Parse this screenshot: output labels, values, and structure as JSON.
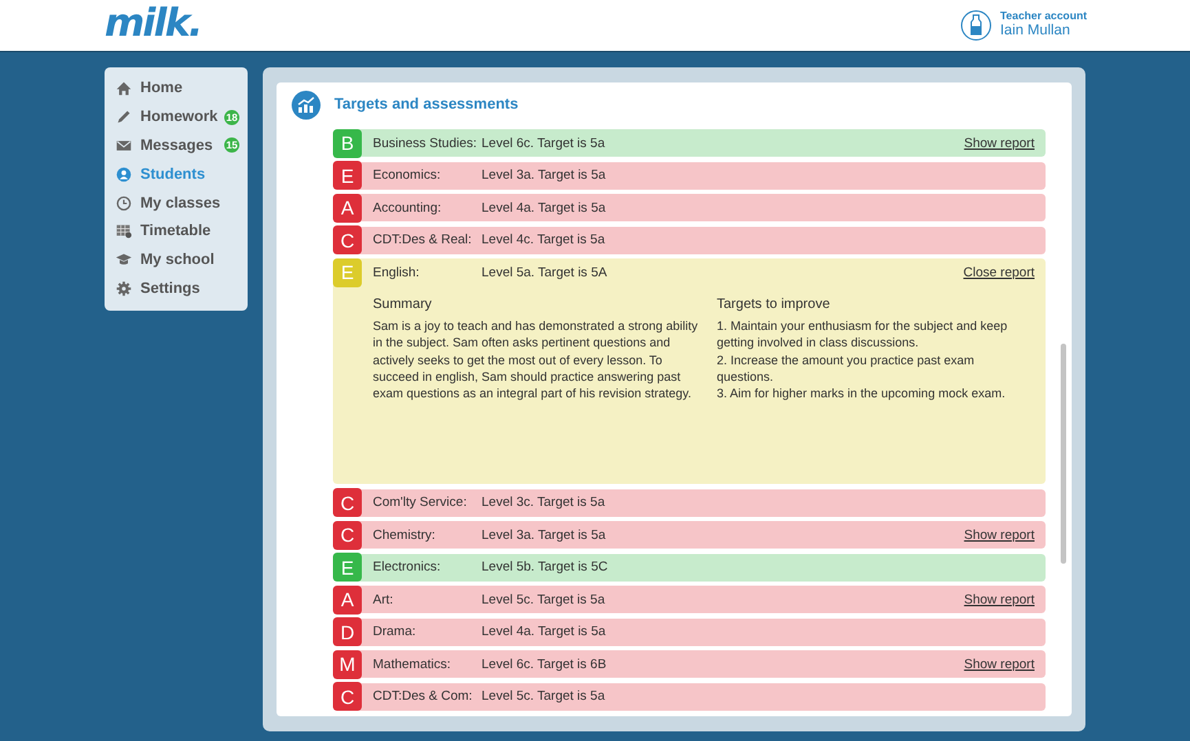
{
  "header": {
    "logo": "milk.",
    "account_type": "Teacher account",
    "account_name": "Iain Mullan"
  },
  "nav": [
    {
      "label": "Home",
      "kind": "home",
      "selected": false
    },
    {
      "label": "Homework",
      "kind": "pencil",
      "selected": false,
      "badge": "18"
    },
    {
      "label": "Messages",
      "kind": "envelope",
      "selected": false,
      "badge": "15"
    },
    {
      "label": "Students",
      "kind": "person",
      "selected": true
    },
    {
      "label": "My classes",
      "kind": "clock",
      "selected": false
    },
    {
      "label": "Timetable",
      "kind": "grid",
      "selected": false
    },
    {
      "label": "My school",
      "kind": "cap",
      "selected": false
    },
    {
      "label": "Settings",
      "kind": "gear",
      "selected": false
    }
  ],
  "panel": {
    "title": "Targets and assessments",
    "rows": [
      {
        "grade": "B",
        "color": "#36b84a",
        "subject": "Business Studies:",
        "result": "Level 6c. Target is 5a",
        "link": "Show report",
        "expanded": false
      },
      {
        "grade": "E",
        "color": "#de2f3a",
        "subject": "Economics:",
        "result": "Level 3a. Target is 5a",
        "expanded": false
      },
      {
        "grade": "A",
        "color": "#de2f3a",
        "subject": "Accounting:",
        "result": "Level 4a. Target is 5a",
        "expanded": false
      },
      {
        "grade": "C",
        "color": "#de2f3a",
        "subject": "CDT:Des & Real:",
        "result": "Level 4c. Target is 5a",
        "expanded": false
      },
      {
        "grade": "E",
        "color": "#dccc2b",
        "subject": "English:",
        "result": "Level 5a. Target is 5A",
        "link": "Close report",
        "expanded": true,
        "summary": {
          "heading": "Summary",
          "text": "Sam is a joy to teach and has demonstrated a strong ability in the subject. Sam often asks pertinent questions and actively seeks to get the most out of every lesson. To succeed in english, Sam should practice answering past exam questions as an integral part of his revision strategy."
        },
        "targets": {
          "heading": "Targets to improve",
          "items": [
            "1. Maintain your enthusiasm for the subject and keep getting involved in class discussions.",
            "2. Increase the amount you practice past exam questions.",
            "3. Aim for higher marks in the upcoming mock exam."
          ]
        }
      },
      {
        "grade": "C",
        "color": "#de2f3a",
        "subject": "Com'lty Service:",
        "result": "Level 3c. Target is 5a",
        "expanded": false
      },
      {
        "grade": "C",
        "color": "#de2f3a",
        "subject": "Chemistry:",
        "result": "Level 3a. Target is 5a",
        "link": "Show report",
        "expanded": false
      },
      {
        "grade": "E",
        "color": "#36b84a",
        "subject": "Electronics:",
        "result": "Level 5b. Target is 5C",
        "expanded": false
      },
      {
        "grade": "A",
        "color": "#de2f3a",
        "subject": "Art:",
        "result": "Level 5c. Target is 5a",
        "link": "Show report",
        "expanded": false
      },
      {
        "grade": "D",
        "color": "#de2f3a",
        "subject": "Drama:",
        "result": "Level 4a. Target is 5a",
        "expanded": false
      },
      {
        "grade": "M",
        "color": "#de2f3a",
        "subject": "Mathematics:",
        "result": "Level 6c. Target is 6B",
        "link": "Show report",
        "expanded": false
      },
      {
        "grade": "C",
        "color": "#de2f3a",
        "subject": "CDT:Des & Com:",
        "result": "Level 5c. Target is 5a",
        "expanded": false
      }
    ]
  }
}
